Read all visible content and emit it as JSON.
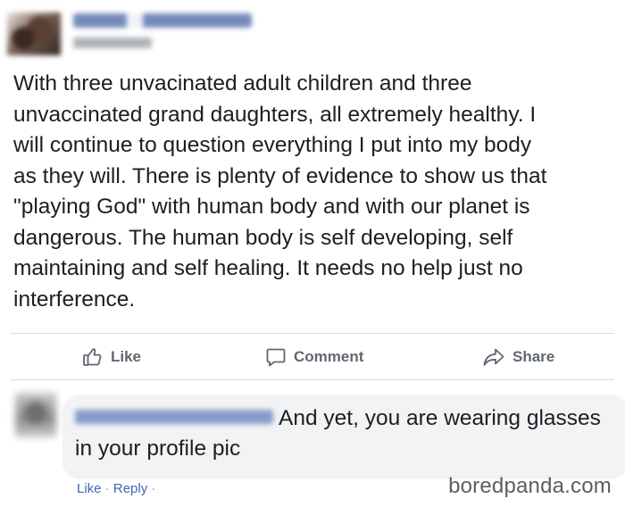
{
  "post": {
    "text": "With three unvacinated adult children and three\nunvaccinated grand daughters, all extremely healthy. I\nwill continue to question everything I put into my body\nas they will. There is plenty of evidence to show us that\n\"playing God\" with human body and with our planet is\ndangerous. The human body is self developing, self\nmaintaining and self healing. It needs no help just no\ninterference."
  },
  "actions": {
    "like": "Like",
    "comment": "Comment",
    "share": "Share"
  },
  "comment": {
    "text": "And yet, you are wearing glasses in your profile pic",
    "like_label": "Like",
    "separator": "·",
    "reply_label": "Reply",
    "trailing_separator": "·"
  },
  "watermark": "boredpanda.com",
  "colors": {
    "text": "#1c1e21",
    "action_gray": "#606770",
    "link_blue": "#4267b2",
    "bubble_bg": "#f2f3f5"
  },
  "icons": [
    "thumbs-up-icon",
    "speech-bubble-icon",
    "share-arrow-icon"
  ]
}
